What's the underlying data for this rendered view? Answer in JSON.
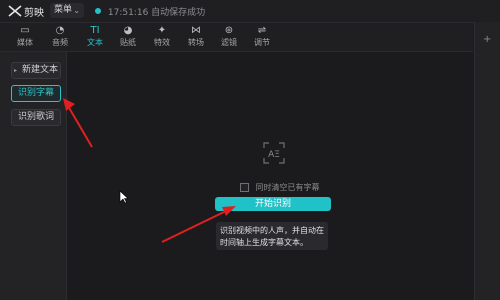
{
  "app": {
    "name": "剪映",
    "menu_label": "菜单",
    "status_text": "17:51:16 自动保存成功"
  },
  "toolbar": {
    "items": [
      {
        "label": "媒体",
        "icon": "media-icon"
      },
      {
        "label": "音频",
        "icon": "audio-icon"
      },
      {
        "label": "文本",
        "icon": "text-icon",
        "active": true
      },
      {
        "label": "贴纸",
        "icon": "sticker-icon"
      },
      {
        "label": "特效",
        "icon": "effects-icon"
      },
      {
        "label": "转场",
        "icon": "transition-icon"
      },
      {
        "label": "滤镜",
        "icon": "filter-icon"
      },
      {
        "label": "调节",
        "icon": "adjust-icon"
      }
    ]
  },
  "left_panel": {
    "items": [
      {
        "label": "新建文本"
      },
      {
        "label": "识别字幕",
        "active": true
      },
      {
        "label": "识别歌词"
      }
    ]
  },
  "main": {
    "placeholder_icon_text": "AΞ",
    "checkbox_label": "同时清空已有字幕",
    "start_button_label": "开始识别",
    "tooltip_text": "识别视频中的人声，并自动在时间轴上生成字幕文本。"
  },
  "colors": {
    "accent": "#21c1c8",
    "annotation_red": "#e02020"
  }
}
